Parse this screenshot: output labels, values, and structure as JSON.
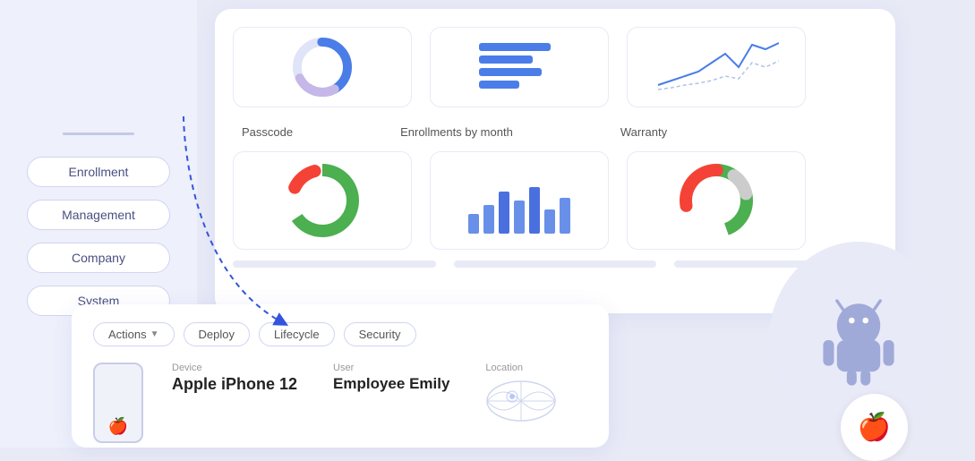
{
  "sidebar": {
    "items": [
      {
        "label": "Enrollment",
        "id": "enrollment"
      },
      {
        "label": "Management",
        "id": "management"
      },
      {
        "label": "Company",
        "id": "company"
      },
      {
        "label": "System",
        "id": "system"
      }
    ]
  },
  "charts": {
    "row1": [
      {
        "id": "donut1",
        "type": "donut-blue"
      },
      {
        "id": "bar1",
        "type": "bar-blue"
      },
      {
        "id": "line1",
        "type": "line-blue"
      }
    ],
    "row2": [
      {
        "label": "Passcode",
        "id": "passcode",
        "type": "donut-green-red"
      },
      {
        "label": "Enrollments by month",
        "id": "enrollments",
        "type": "bar-enrollments"
      },
      {
        "label": "Warranty",
        "id": "warranty",
        "type": "donut-warranty"
      }
    ]
  },
  "bottom_card": {
    "tabs": [
      {
        "label": "Actions",
        "id": "actions",
        "has_arrow": true
      },
      {
        "label": "Deploy",
        "id": "deploy",
        "has_arrow": false
      },
      {
        "label": "Lifecycle",
        "id": "lifecycle",
        "has_arrow": false
      },
      {
        "label": "Security",
        "id": "security",
        "has_arrow": false
      }
    ],
    "device": {
      "label": "Device",
      "value": "Apple iPhone 12"
    },
    "user": {
      "label": "User",
      "value": "Employee Emily"
    },
    "location": {
      "label": "Location"
    }
  },
  "colors": {
    "accent": "#4a5de8",
    "green": "#4caf50",
    "red": "#f44336",
    "gray": "#cccccc",
    "blue_light": "#7a9de8",
    "sidebar_bg": "#eef0fb"
  }
}
